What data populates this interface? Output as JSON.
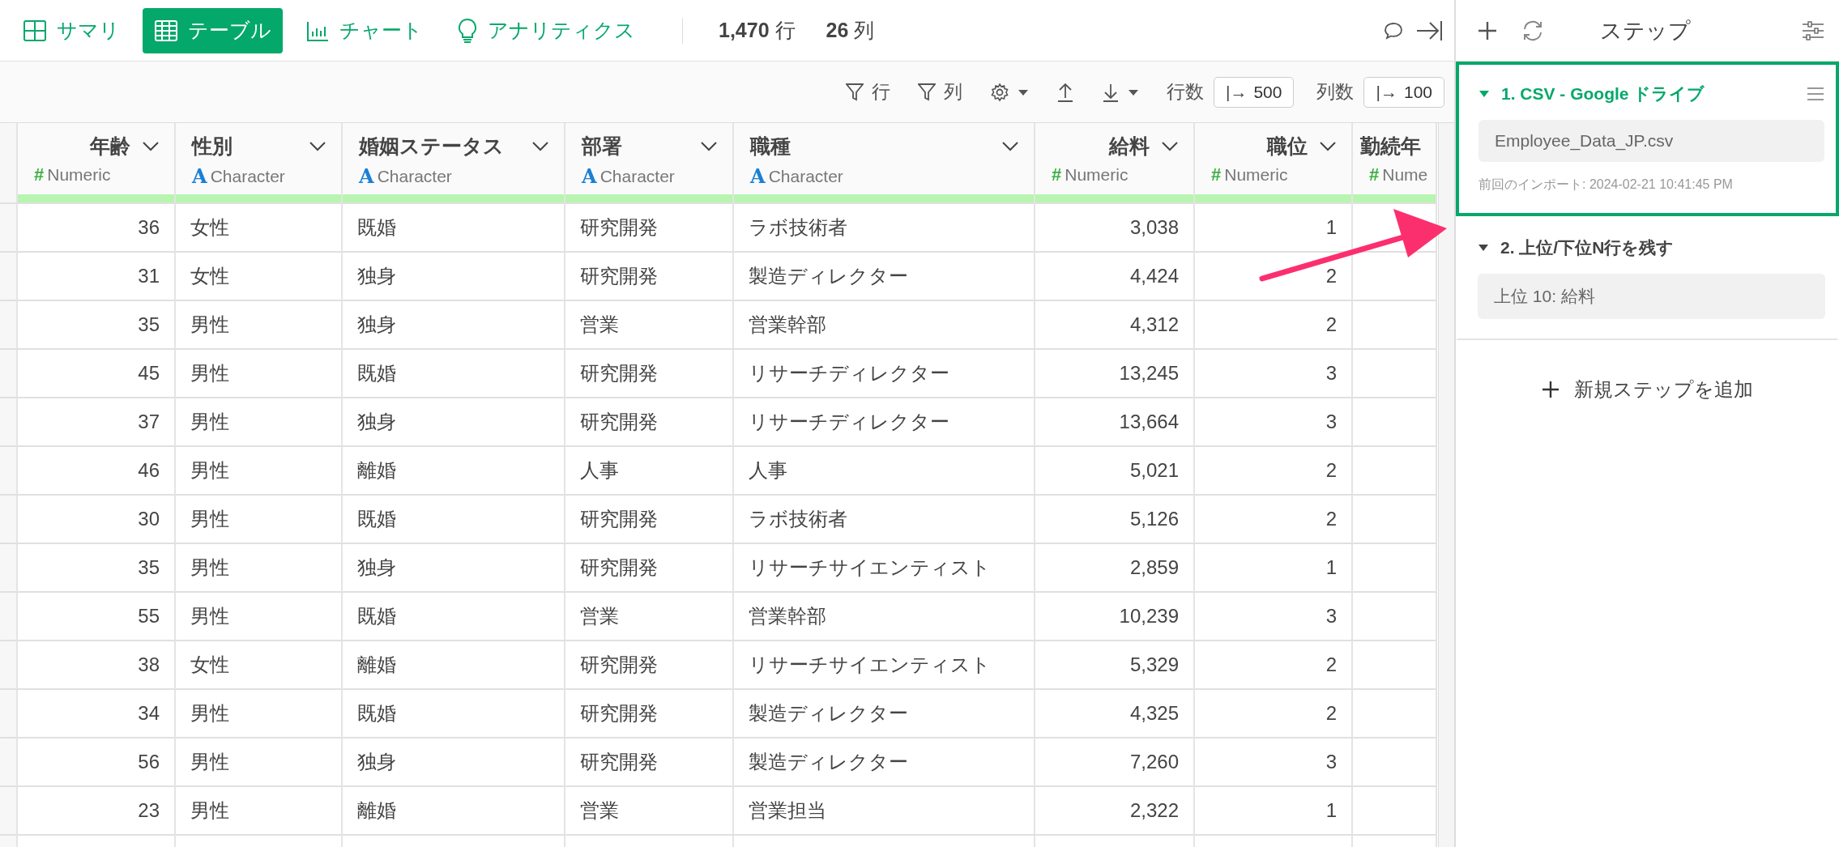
{
  "view_tabs": [
    {
      "label": "サマリ",
      "selected": false
    },
    {
      "label": "テーブル",
      "selected": true
    },
    {
      "label": "チャート",
      "selected": false
    },
    {
      "label": "アナリティクス",
      "selected": false
    }
  ],
  "counts": [
    {
      "value": "1,470",
      "unit": "行"
    },
    {
      "value": "26",
      "unit": "列"
    }
  ],
  "toolbar": {
    "row_filter": "行",
    "column_filter": "列",
    "row_count_label": "行数",
    "row_count_icon": "|→",
    "row_count": "500",
    "column_count_label": "列数",
    "column_count_icon": "|→",
    "column_count": "100"
  },
  "table": {
    "columns": [
      {
        "name": "年齢",
        "kind": "numeric",
        "type_icon": "#",
        "type_label": "Numeric"
      },
      {
        "name": "性別",
        "kind": "character",
        "type_icon": "A",
        "type_label": "Character"
      },
      {
        "name": "婚姻ステータス",
        "kind": "character",
        "type_icon": "A",
        "type_label": "Character"
      },
      {
        "name": "部署",
        "kind": "character",
        "type_icon": "A",
        "type_label": "Character"
      },
      {
        "name": "職種",
        "kind": "character",
        "type_icon": "A",
        "type_label": "Character"
      },
      {
        "name": "給料",
        "kind": "numeric",
        "type_icon": "#",
        "type_label": "Numeric"
      },
      {
        "name": "職位",
        "kind": "numeric",
        "type_icon": "#",
        "type_label": "Numeric"
      },
      {
        "name": "勤続年",
        "kind": "numeric",
        "type_icon": "#",
        "type_label": "Nume"
      }
    ],
    "rows": [
      [
        "36",
        "女性",
        "既婚",
        "研究開発",
        "ラボ技術者",
        "3,038",
        "1"
      ],
      [
        "31",
        "女性",
        "独身",
        "研究開発",
        "製造ディレクター",
        "4,424",
        "2"
      ],
      [
        "35",
        "男性",
        "独身",
        "営業",
        "営業幹部",
        "4,312",
        "2"
      ],
      [
        "45",
        "男性",
        "既婚",
        "研究開発",
        "リサーチディレクター",
        "13,245",
        "3"
      ],
      [
        "37",
        "男性",
        "独身",
        "研究開発",
        "リサーチディレクター",
        "13,664",
        "3"
      ],
      [
        "46",
        "男性",
        "離婚",
        "人事",
        "人事",
        "5,021",
        "2"
      ],
      [
        "30",
        "男性",
        "既婚",
        "研究開発",
        "ラボ技術者",
        "5,126",
        "2"
      ],
      [
        "35",
        "男性",
        "独身",
        "研究開発",
        "リサーチサイエンティスト",
        "2,859",
        "1"
      ],
      [
        "55",
        "男性",
        "既婚",
        "営業",
        "営業幹部",
        "10,239",
        "3"
      ],
      [
        "38",
        "女性",
        "離婚",
        "研究開発",
        "リサーチサイエンティスト",
        "5,329",
        "2"
      ],
      [
        "34",
        "男性",
        "既婚",
        "研究開発",
        "製造ディレクター",
        "4,325",
        "2"
      ],
      [
        "56",
        "男性",
        "独身",
        "研究開発",
        "製造ディレクター",
        "7,260",
        "3"
      ],
      [
        "23",
        "男性",
        "離婚",
        "営業",
        "営業担当",
        "2,322",
        "1"
      ]
    ]
  },
  "steps_panel": {
    "title": "ステップ",
    "steps": [
      {
        "title": "1. CSV - Google ドライブ",
        "selected": true,
        "expanded": true,
        "detail": "Employee_Data_JP.csv",
        "note": "前回のインポート: 2024-02-21 10:41:45 PM"
      },
      {
        "title": "2. 上位/下位N行を残す",
        "selected": false,
        "expanded": true,
        "detail": "上位 10: 給料"
      }
    ],
    "add_step": "新規ステップを追加"
  }
}
